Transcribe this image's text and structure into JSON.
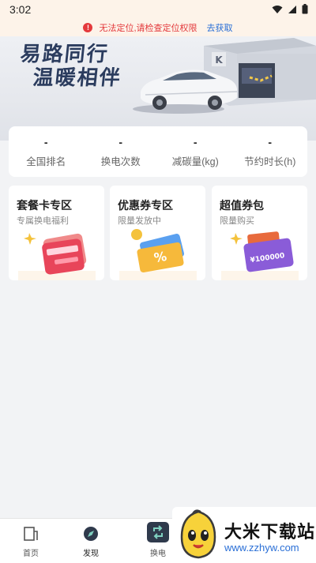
{
  "status_bar": {
    "time": "3:02",
    "icons": [
      "wifi-icon",
      "signal-icon",
      "battery-icon"
    ]
  },
  "warning": {
    "text": "无法定位,请检查定位权限",
    "action": "去获取",
    "icon": "alert-icon"
  },
  "hero": {
    "line1": "易路同行",
    "line2": "温暖相伴"
  },
  "stats": [
    {
      "value": "-",
      "label": "全国排名"
    },
    {
      "value": "-",
      "label": "换电次数"
    },
    {
      "value": "-",
      "label": "减碳量(kg)"
    },
    {
      "value": "-",
      "label": "节约时长(h)"
    }
  ],
  "promos": [
    {
      "title": "套餐卡专区",
      "subtitle": "专属换电福利",
      "icon": "card-package-icon"
    },
    {
      "title": "优惠券专区",
      "subtitle": "限量发放中",
      "icon": "coupon-icon",
      "art_text": "%"
    },
    {
      "title": "超值券包",
      "subtitle": "限量购买",
      "icon": "coupon-pack-icon",
      "art_text": "¥100000"
    }
  ],
  "tabs": [
    {
      "label": "首页",
      "icon": "home-icon"
    },
    {
      "label": "发现",
      "icon": "discover-icon"
    },
    {
      "label": "换电",
      "icon": "swap-battery-icon"
    }
  ],
  "ad": {
    "title": "大米下载站",
    "url": "www.zzhyw.com",
    "icon": "mascot-icon"
  },
  "colors": {
    "alert": "#e4393c",
    "link": "#2a6fd6",
    "hero_text": "#2b3c5e",
    "tab_dark": "#2f3a4c"
  }
}
